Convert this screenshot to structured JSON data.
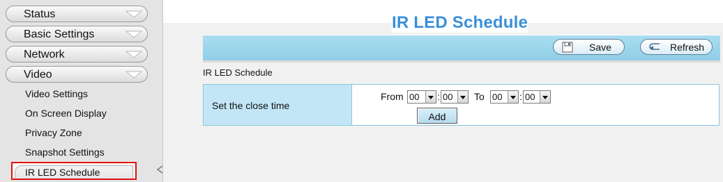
{
  "sidebar": {
    "menus": [
      {
        "label": "Status"
      },
      {
        "label": "Basic Settings"
      },
      {
        "label": "Network"
      },
      {
        "label": "Video"
      }
    ],
    "sub_items": [
      {
        "label": "Video Settings"
      },
      {
        "label": "On Screen Display"
      },
      {
        "label": "Privacy Zone"
      },
      {
        "label": "Snapshot Settings"
      }
    ],
    "active_item": "IR LED Schedule"
  },
  "page": {
    "title": "IR LED Schedule",
    "section_label": "IR LED Schedule"
  },
  "toolbar": {
    "save_label": "Save",
    "refresh_label": "Refresh"
  },
  "form": {
    "row_label": "Set the close time",
    "from_label": "From",
    "to_label": "To",
    "separator": ":",
    "from_hour": "00",
    "from_minute": "00",
    "to_hour": "00",
    "to_minute": "00",
    "add_label": "Add"
  },
  "colors": {
    "title": "#3a8fd9",
    "toolbar": "#9dd6ec",
    "label_cell": "#c3e6f7",
    "highlight": "#e01010"
  }
}
